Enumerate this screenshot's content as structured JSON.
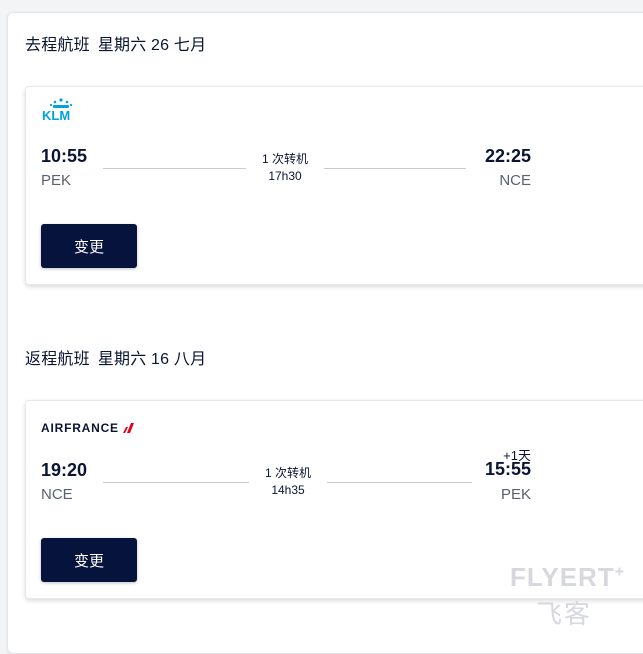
{
  "outbound": {
    "section_title": "去程航班",
    "date": "星期六 26 七月",
    "airline": "KLM",
    "depart_time": "10:55",
    "depart_airport": "PEK",
    "stops": "1 次转机",
    "duration": "17h30",
    "arrive_time": "22:25",
    "arrive_airport": "NCE",
    "change_label": "变更"
  },
  "return": {
    "section_title": "返程航班",
    "date": "星期六 16 八月",
    "airline": "AIRFRANCE",
    "depart_time": "19:20",
    "depart_airport": "NCE",
    "stops": "1 次转机",
    "duration": "14h35",
    "day_offset": "+1天",
    "arrive_time": "15:55",
    "arrive_airport": "PEK",
    "change_label": "变更"
  },
  "watermark": {
    "text": "FLYERT",
    "plus": "+",
    "sub": "飞客"
  },
  "colors": {
    "button": "#06133d",
    "klm_blue": "#00a1de",
    "airfrance_red": "#e2001a"
  }
}
